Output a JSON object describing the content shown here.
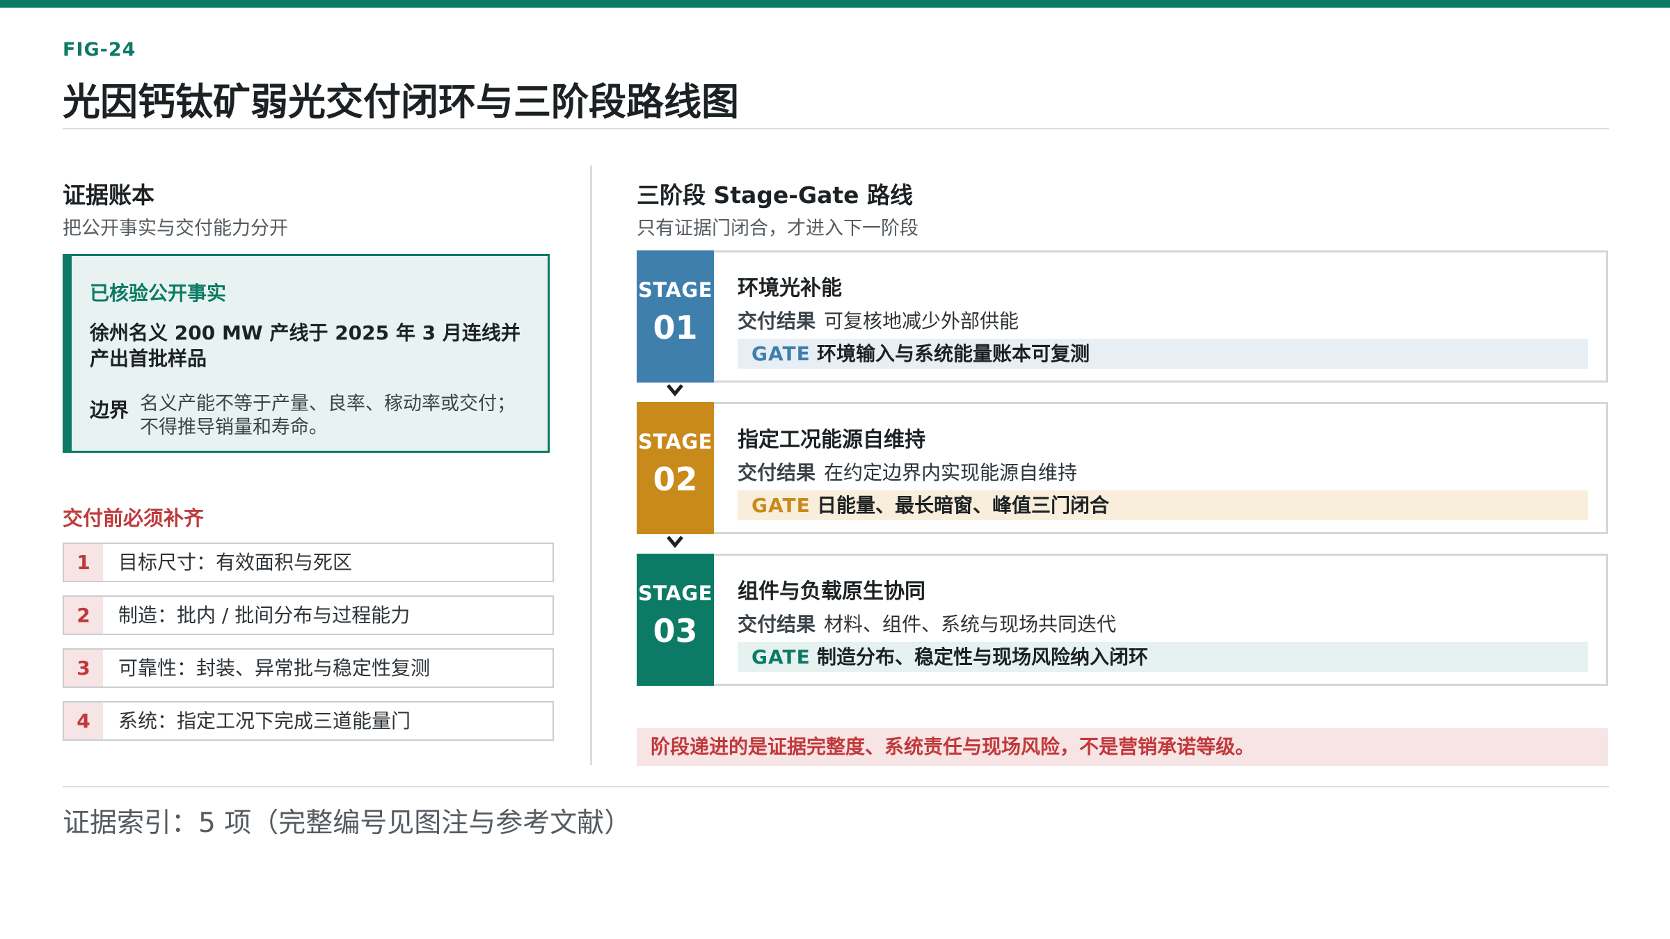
{
  "header": {
    "fig_label": "FIG-24",
    "title": "光因钙钛矿弱光交付闭环与三阶段路线图"
  },
  "colors": {
    "brand": "#0c7a64",
    "stage1": "#3f7fab",
    "stage2": "#c98a1c",
    "stage3": "#0c7a64",
    "alert": "#c0393b"
  },
  "ledger": {
    "title": "证据账本",
    "subtitle": "把公开事实与交付能力分开",
    "verified": {
      "heading": "已核验公开事实",
      "fact": "徐州名义 200 MW 产线于 2025 年 3 月连线并产出首批样品",
      "boundary_label": "边界",
      "boundary_text": "名义产能不等于产量、良率、稼动率或交付；不得推导销量和寿命。"
    },
    "requirements": {
      "title": "交付前必须补齐",
      "items": [
        {
          "num": "1",
          "text": "目标尺寸：有效面积与死区"
        },
        {
          "num": "2",
          "text": "制造：批内 / 批间分布与过程能力"
        },
        {
          "num": "3",
          "text": "可靠性：封装、异常批与稳定性复测"
        },
        {
          "num": "4",
          "text": "系统：指定工况下完成三道能量门"
        }
      ]
    }
  },
  "roadmap": {
    "title": "三阶段 Stage-Gate 路线",
    "subtitle": "只有证据门闭合，才进入下一阶段",
    "stage_word": "STAGE",
    "result_label": "交付结果",
    "gate_word": "GATE",
    "stages": [
      {
        "num": "01",
        "title": "环境光补能",
        "result": "可复核地减少外部供能",
        "gate": "环境输入与系统能量账本可复测"
      },
      {
        "num": "02",
        "title": "指定工况能源自维持",
        "result": "在约定边界内实现能源自维持",
        "gate": "日能量、最长暗窗、峰值三门闭合"
      },
      {
        "num": "03",
        "title": "组件与负载原生协同",
        "result": "材料、组件、系统与现场共同迭代",
        "gate": "制造分布、稳定性与现场风险纳入闭环"
      }
    ],
    "note": "阶段递进的是证据完整度、系统责任与现场风险，不是营销承诺等级。"
  },
  "footer": {
    "text": "证据索引：5 项（完整编号见图注与参考文献）"
  }
}
